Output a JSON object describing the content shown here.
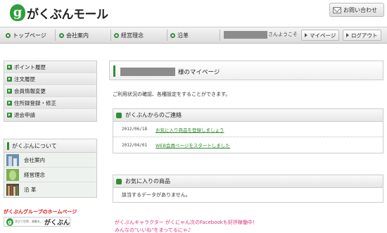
{
  "header": {
    "logo_mark": "g",
    "logo_text": "がくぶんモール",
    "contact_label": "お問い合わせ"
  },
  "nav": {
    "items": [
      {
        "label": "トップページ"
      },
      {
        "label": "会社案内"
      },
      {
        "label": "経営理念"
      },
      {
        "label": "沿革"
      }
    ],
    "greeting": "さんようこそ",
    "mypage_label": "マイページ",
    "logout_label": "ログアウト"
  },
  "sidebar": {
    "menu": [
      {
        "label": "ポイント履歴"
      },
      {
        "label": "注文履歴"
      },
      {
        "label": "会員情報変更"
      },
      {
        "label": "住所録登録・修正"
      },
      {
        "label": "退会申請"
      }
    ],
    "about_title": "がくぶんについて",
    "about_items": [
      {
        "label": "会社案内"
      },
      {
        "label": "経営理念"
      },
      {
        "label": "沿 革"
      }
    ],
    "group_title": "がくぶんグループのホームページ",
    "group_banner": {
      "mark": "g",
      "text": "がくぶん",
      "tagline": "学びで世界、感動を。"
    }
  },
  "main": {
    "mypage_title": "様のマイページ",
    "intro": "ご利用状況の確認、各種設定をすることができます。",
    "news": {
      "title": "がくぶんからのご連絡",
      "rows": [
        {
          "date": "2012/06/18",
          "text": "お気に入り商品を登録しましょう"
        },
        {
          "date": "2012/04/01",
          "text": "WEB会員ページをスタートしました"
        }
      ]
    },
    "favorites": {
      "title": "お気に入りの商品",
      "empty_text": "該当するデータがありません。"
    },
    "promo_line1": "がくぶんキャラクター がくにゃん次のFacebookも好評稼働中！",
    "promo_line2": "みんなの\"いいね\"をまってるにゃ♪"
  },
  "colors": {
    "brand_green": "#2f8f34",
    "link_green": "#2c8a2c",
    "promo_pink": "#e0337a",
    "group_red": "#dd1111",
    "redaction_gray": "#8c8c8c"
  }
}
